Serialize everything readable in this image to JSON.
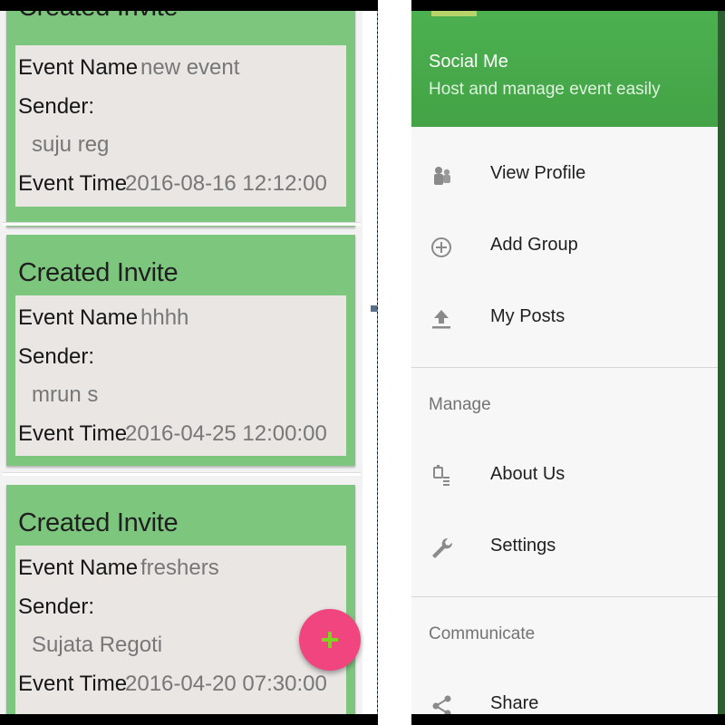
{
  "invites": [
    {
      "title": "Created Invite",
      "event_name_label": "Event Name",
      "event_name": "new event",
      "sender_label": "Sender:",
      "sender": "suju reg",
      "event_time_label": "Event Time",
      "event_time": "2016-08-16 12:12:00"
    },
    {
      "title": "Created Invite",
      "event_name_label": "Event Name",
      "event_name": "hhhh",
      "sender_label": "Sender:",
      "sender": "mrun s",
      "event_time_label": "Event Time",
      "event_time": "2016-04-25 12:00:00"
    },
    {
      "title": "Created Invite",
      "event_name_label": "Event Name",
      "event_name": "freshers",
      "sender_label": "Sender:",
      "sender": "Sujata Regoti",
      "event_time_label": "Event Time",
      "event_time": "2016-04-20 07:30:00"
    }
  ],
  "fab": {
    "icon": "plus-icon",
    "color": "#f0457e",
    "icon_color": "#7ed321"
  },
  "drawer": {
    "header": {
      "title": "Social Me",
      "subtitle": "Host and manage event easily",
      "color": "#4cb050"
    },
    "items": [
      {
        "label": "View Profile",
        "icon": "people-icon"
      },
      {
        "label": "Add Group",
        "icon": "add-circle-icon"
      },
      {
        "label": "My Posts",
        "icon": "upload-icon"
      }
    ],
    "sections": [
      {
        "title": "Manage",
        "items": [
          {
            "label": "About Us",
            "icon": "about-icon"
          },
          {
            "label": "Settings",
            "icon": "wrench-icon"
          }
        ]
      },
      {
        "title": "Communicate",
        "items": [
          {
            "label": "Share",
            "icon": "share-icon"
          }
        ]
      }
    ]
  }
}
